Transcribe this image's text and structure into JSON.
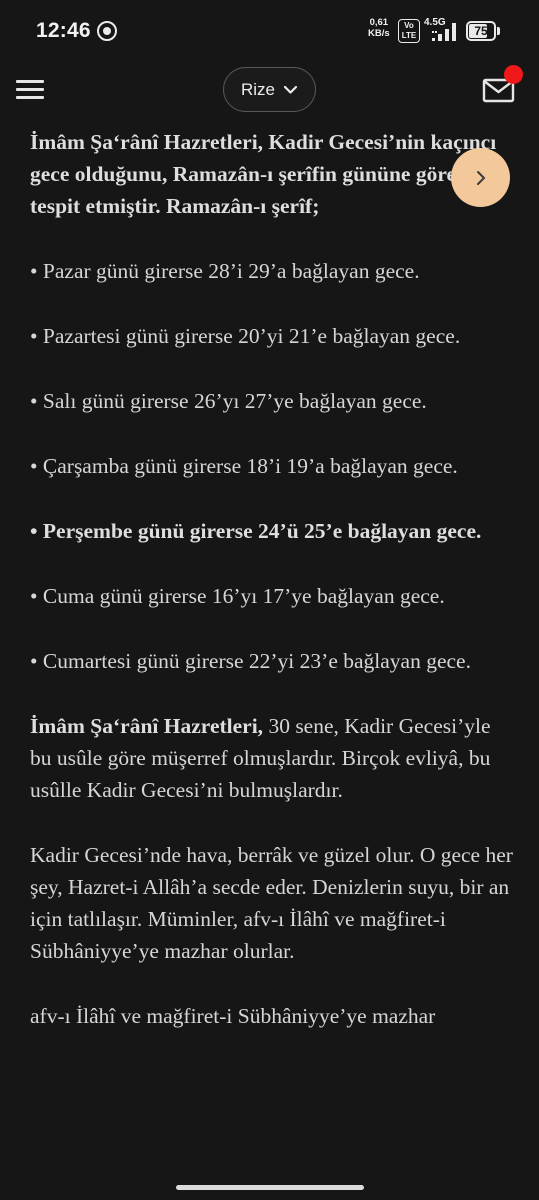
{
  "status_bar": {
    "time": "12:46",
    "net_speed_value": "0,61",
    "net_speed_unit": "KB/s",
    "volte_top": "Vo",
    "volte_bottom": "LTE",
    "network_type": "4.5G",
    "battery_level": "75",
    "battery_fraction": 0.75
  },
  "header": {
    "city": "Rize",
    "icons": [
      "menu-icon",
      "chevron-down-icon",
      "mail-icon"
    ],
    "notification_color": "#f01818"
  },
  "article": {
    "intro": "İmâm Şa‘rânî Hazretleri, Kadir Gecesi’nin kaçıncı gece olduğunu, Ramazân-ı şerîfin gününe göre şöyle tespit etmiştir. Ramazân-ı şerîf;",
    "items": [
      "• Pazar günü girerse 28’i 29’a bağlayan gece.",
      "• Pazartesi günü girerse 20’yi 21’e bağlayan gece.",
      "• Salı günü girerse 26’yı 27’ye bağlayan gece.",
      "• Çarşamba günü girerse 18’i 19’a bağlayan gece.",
      "• Perşembe günü girerse 24’ü 25’e bağlayan gece.",
      "• Cuma günü girerse 16’yı 17’ye bağlayan gece.",
      "• Cumartesi günü girerse 22’yi 23’e bağlayan gece."
    ],
    "para2_bold": "İmâm Şa‘rânî Hazretleri,",
    "para2_rest": " 30 sene, Kadir Gecesi’yle bu usûle göre müşerref olmuşlardır. Birçok evliyâ, bu usûlle Kadir Gecesi’ni bulmuşlardır.",
    "para3": "Kadir Gecesi’nde hava, berrâk ve güzel olur. O gece her şey, Hazret-i Allâh’a secde eder. Denizlerin suyu, bir an için tatlılaşır. Müminler, afv-ı İlâhî ve mağfiret-i Sübhâniyye’ye mazhar olurlar.",
    "para4_partial": "afv-ı İlâhî ve mağfiret-i Sübhâniyye’ye mazhar"
  },
  "accent_color": "#f3c89a"
}
